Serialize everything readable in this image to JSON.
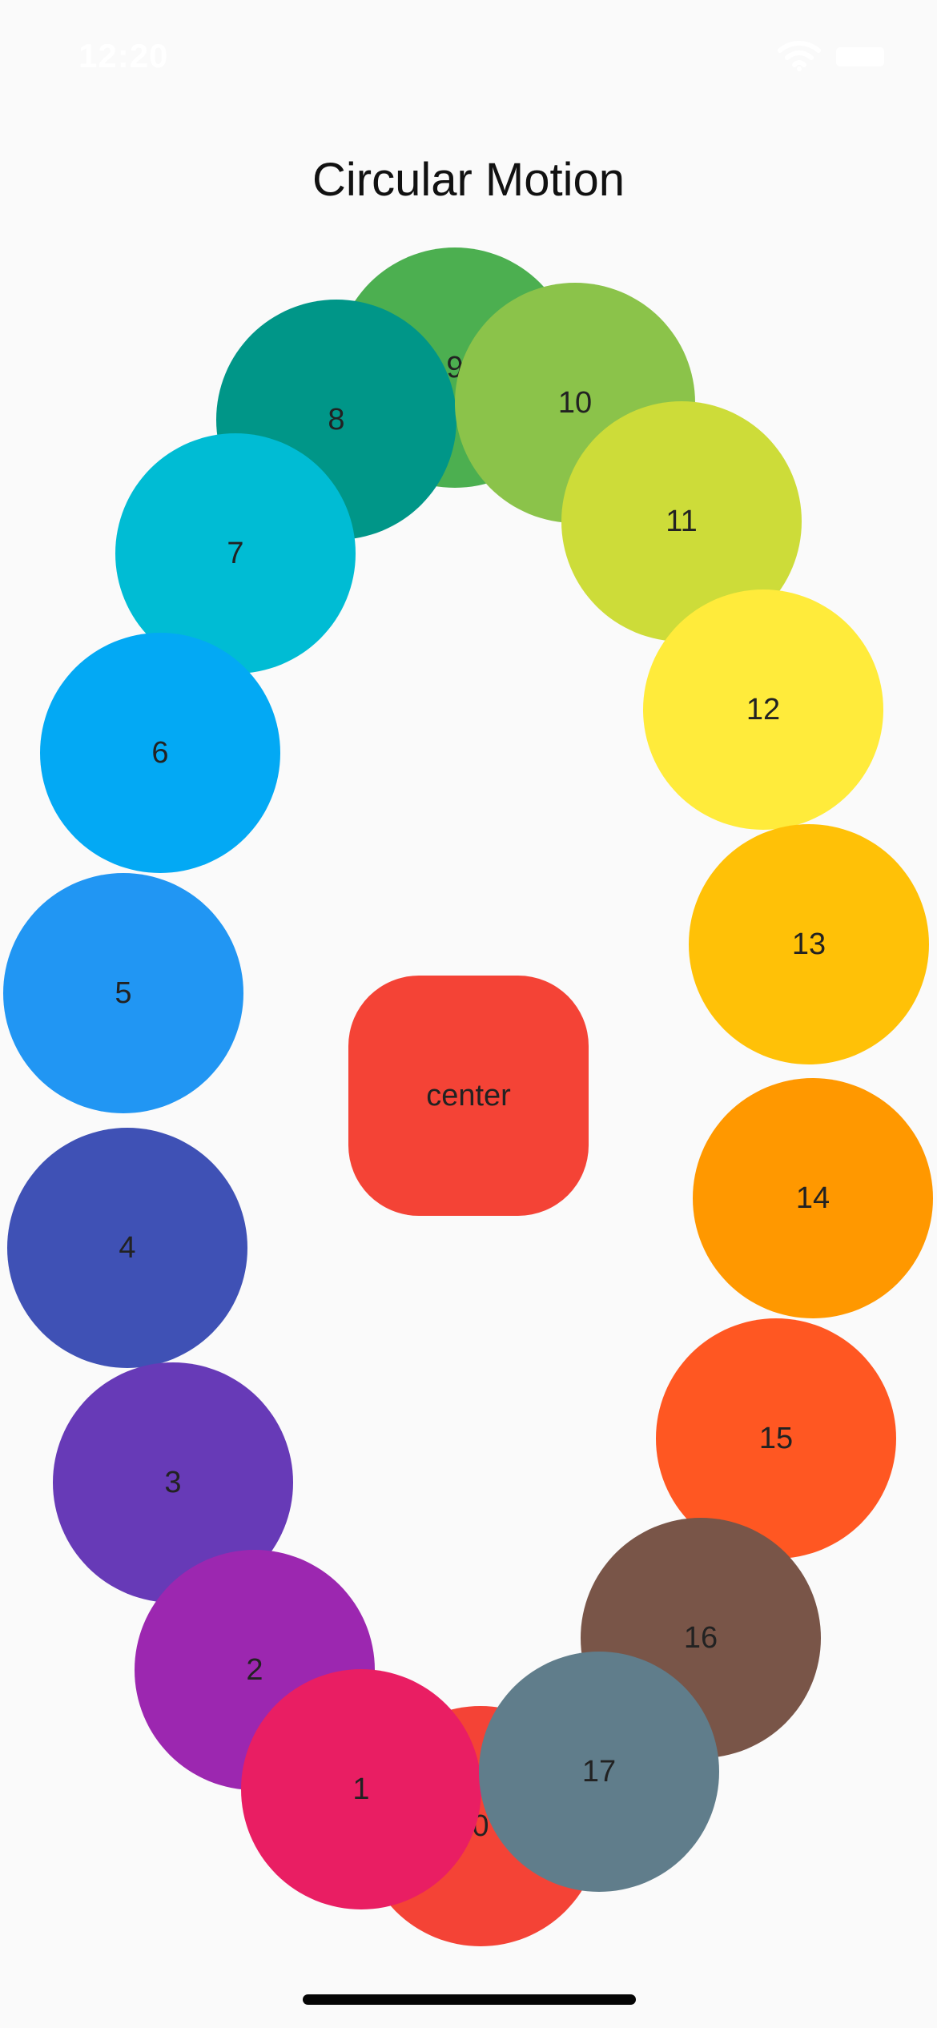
{
  "status_bar": {
    "time": "12:20",
    "wifi_icon": "wifi-icon",
    "battery_icon": "battery-icon"
  },
  "page": {
    "title": "Circular Motion",
    "center_label": "center"
  },
  "circles": [
    {
      "label": "0",
      "color": "#F44336"
    },
    {
      "label": "1",
      "color": "#E91E63"
    },
    {
      "label": "2",
      "color": "#9C27B0"
    },
    {
      "label": "3",
      "color": "#673AB7"
    },
    {
      "label": "4",
      "color": "#3F51B5"
    },
    {
      "label": "5",
      "color": "#2196F3"
    },
    {
      "label": "6",
      "color": "#03A9F4"
    },
    {
      "label": "7",
      "color": "#00BCD4"
    },
    {
      "label": "8",
      "color": "#009688"
    },
    {
      "label": "9",
      "color": "#4CAF50"
    },
    {
      "label": "10",
      "color": "#8BC34A"
    },
    {
      "label": "11",
      "color": "#CDDC39"
    },
    {
      "label": "12",
      "color": "#FFEB3B"
    },
    {
      "label": "13",
      "color": "#FFC107"
    },
    {
      "label": "14",
      "color": "#FF9800"
    },
    {
      "label": "15",
      "color": "#FF5722"
    },
    {
      "label": "16",
      "color": "#795548"
    },
    {
      "label": "17",
      "color": "#607D8B"
    }
  ],
  "colors": {
    "background": "#fafafa",
    "center_button": "#F44336",
    "status_text": "#ffffff",
    "title_text": "#111111",
    "label_text": "#222222",
    "home_indicator": "#050505"
  }
}
